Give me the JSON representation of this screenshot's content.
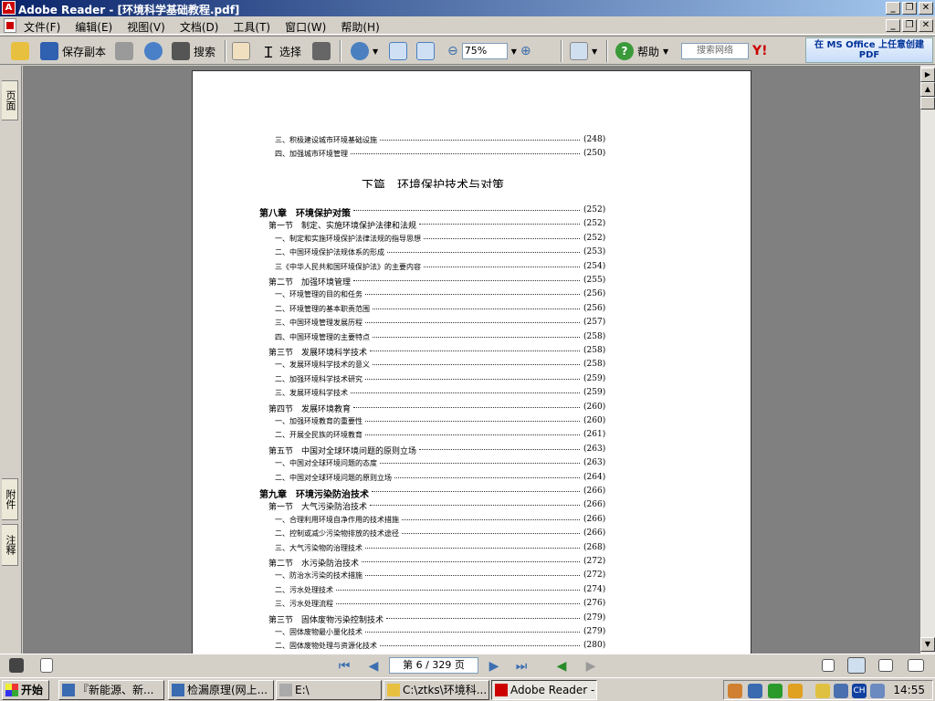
{
  "window": {
    "title": "Adobe Reader - [环境科学基础教程.pdf]",
    "app_icon": "adobe-reader-icon"
  },
  "menu": [
    "文件(F)",
    "编辑(E)",
    "视图(V)",
    "文档(D)",
    "工具(T)",
    "窗口(W)",
    "帮助(H)"
  ],
  "toolbar": {
    "save_copy": "保存副本",
    "search": "搜索",
    "select": "选择",
    "zoom": "75%",
    "help": "帮助",
    "web_search_placeholder": "搜索网络",
    "promo": "在 MS Office 上任意创建 PDF"
  },
  "left_tabs": {
    "pages": "页面",
    "attachments": "附件",
    "comments": "注释"
  },
  "document": {
    "lines": [
      {
        "kind": "item",
        "text": "三、积极建设城市环境基础设施",
        "page": "(248)"
      },
      {
        "kind": "item",
        "text": "四、加强城市环境管理",
        "page": "(250)"
      },
      {
        "kind": "part",
        "text": "下篇　环境保护技术与对策",
        "page": ""
      },
      {
        "kind": "chapter",
        "text": "第八章　环境保护对策",
        "page": "(252)"
      },
      {
        "kind": "section",
        "text": "第一节　制定、实施环境保护法律和法规",
        "page": "(252)"
      },
      {
        "kind": "item",
        "text": "一、制定和实施环境保护法律法规的指导思想",
        "page": "(252)"
      },
      {
        "kind": "item",
        "text": "二、中国环境保护法规体系的形成",
        "page": "(253)"
      },
      {
        "kind": "item",
        "text": "三《中华人民共和国环境保护法》的主要内容",
        "page": "(254)"
      },
      {
        "kind": "section",
        "text": "第二节　加强环境管理",
        "page": "(255)"
      },
      {
        "kind": "item",
        "text": "一、环境管理的目的和任务",
        "page": "(256)"
      },
      {
        "kind": "item",
        "text": "二、环境管理的基本职责范围",
        "page": "(256)"
      },
      {
        "kind": "item",
        "text": "三、中国环境管理发展历程",
        "page": "(257)"
      },
      {
        "kind": "item",
        "text": "四、中国环境管理的主要特点",
        "page": "(258)"
      },
      {
        "kind": "section",
        "text": "第三节　发展环境科学技术",
        "page": "(258)"
      },
      {
        "kind": "item",
        "text": "一、发展环境科学技术的意义",
        "page": "(258)"
      },
      {
        "kind": "item",
        "text": "二、加强环境科学技术研究",
        "page": "(259)"
      },
      {
        "kind": "item",
        "text": "三、发展环境科学技术",
        "page": "(259)"
      },
      {
        "kind": "section",
        "text": "第四节　发展环境教育",
        "page": "(260)"
      },
      {
        "kind": "item",
        "text": "一、加强环境教育的重要性",
        "page": "(260)"
      },
      {
        "kind": "item",
        "text": "二、开展全民族的环境教育",
        "page": "(261)"
      },
      {
        "kind": "section",
        "text": "第五节　中国对全球环境问题的原则立场",
        "page": "(263)"
      },
      {
        "kind": "item",
        "text": "一、中国对全球环境问题的态度",
        "page": "(263)"
      },
      {
        "kind": "item",
        "text": "二、中国对全球环境问题的原则立场",
        "page": "(264)"
      },
      {
        "kind": "chapter",
        "text": "第九章　环境污染防治技术",
        "page": "(266)"
      },
      {
        "kind": "section",
        "text": "第一节　大气污染防治技术",
        "page": "(266)"
      },
      {
        "kind": "item",
        "text": "一、合理利用环境自净作用的技术措施",
        "page": "(266)"
      },
      {
        "kind": "item",
        "text": "二、控制或减少污染物排放的技术途径",
        "page": "(266)"
      },
      {
        "kind": "item",
        "text": "三、大气污染物的治理技术",
        "page": "(268)"
      },
      {
        "kind": "section",
        "text": "第二节　水污染防治技术",
        "page": "(272)"
      },
      {
        "kind": "item",
        "text": "一、防治水污染的技术措施",
        "page": "(272)"
      },
      {
        "kind": "item",
        "text": "二、污水处理技术",
        "page": "(274)"
      },
      {
        "kind": "item",
        "text": "三、污水处理流程",
        "page": "(276)"
      },
      {
        "kind": "section",
        "text": "第三节　固体废物污染控制技术",
        "page": "(279)"
      },
      {
        "kind": "item",
        "text": "一、固体废物最小量化技术",
        "page": "(279)"
      },
      {
        "kind": "item",
        "text": "二、固体废物处理与资源化技术",
        "page": "(280)"
      }
    ]
  },
  "status": {
    "page_indicator": "第 6 / 329 页"
  },
  "taskbar": {
    "start": "开始",
    "tasks": [
      "『新能源、新...",
      "检漏原理(网上...",
      "E:\\",
      "C:\\ztks\\环境科...",
      "Adobe Reader - ..."
    ],
    "clock": "14:55",
    "ime": "CH"
  },
  "colors": {
    "title_start": "#0a246a",
    "title_end": "#a6caf0",
    "doc_bg": "#808080"
  }
}
